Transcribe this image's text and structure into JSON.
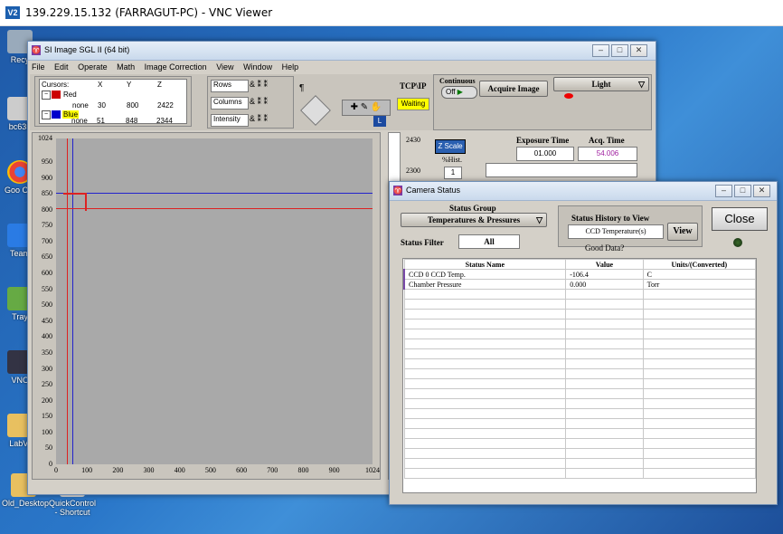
{
  "vnc": {
    "title": "139.229.15.132 (FARRAGUT-PC) - VNC Viewer",
    "logo": "V2"
  },
  "desktop": {
    "icons": [
      {
        "label": "Recy",
        "color": "#8aa"
      },
      {
        "label": "bc635",
        "color": "#ccc"
      },
      {
        "label": "Goo Chr",
        "color": "#e44"
      },
      {
        "label": "Team",
        "color": "#2a7be4"
      },
      {
        "label": "Tray",
        "color": "#8a4"
      },
      {
        "label": "VNC",
        "color": "#336"
      },
      {
        "label": "LabVI",
        "color": "#e8c060"
      },
      {
        "label": "Old_Desktop",
        "color": "#e8c060"
      },
      {
        "label": "QuickControl - Shortcut",
        "color": "#ddd"
      }
    ]
  },
  "si_window": {
    "title": "SI Image SGL II  (64 bit)",
    "menu": [
      "File",
      "Edit",
      "Operate",
      "Math",
      "Image Correction",
      "View",
      "Window",
      "Help"
    ],
    "cursors": {
      "headers": [
        "Cursors:",
        "X",
        "Y",
        "Z"
      ],
      "rows": [
        {
          "name": "Red",
          "mode": "none",
          "x": "30",
          "y": "800",
          "z": "2422"
        },
        {
          "name": "Blue",
          "mode": "none",
          "x": "51",
          "y": "848",
          "z": "2344"
        }
      ]
    },
    "profile_labels": [
      "Rows",
      "Columns",
      "Intensity"
    ],
    "tcpip_label": "TCP\\IP",
    "tcpip_status": "Waiting",
    "l_badge": "L",
    "continuous_label": "Continuous",
    "off_label": "Off",
    "acquire_label": "Acquire Image",
    "light_label": "Light",
    "zscale_label": "Z Scale",
    "hist_label": "%Hist.",
    "hist_value": "1",
    "exposure_label": "Exposure Time",
    "exposure_value": "01.000",
    "acq_label": "Acq. Time",
    "acq_value": "54.006",
    "scale_values": [
      "2430",
      "2300"
    ],
    "y_ticks": [
      "1024",
      "950",
      "900",
      "850",
      "800",
      "750",
      "700",
      "650",
      "600",
      "550",
      "500",
      "450",
      "400",
      "350",
      "300",
      "250",
      "200",
      "150",
      "100",
      "50",
      "0"
    ],
    "x_ticks": [
      "0",
      "100",
      "200",
      "300",
      "400",
      "500",
      "600",
      "700",
      "800",
      "900",
      "1024"
    ],
    "pin_icon": "¶"
  },
  "camera_status": {
    "title": "Camera Status",
    "status_group_label": "Status Group",
    "status_group_value": "Temperatures & Pressures",
    "status_filter_label": "Status Filter",
    "status_filter_value": "All",
    "history_label": "Status History to View",
    "history_value": "CCD Temperature(s)",
    "view_label": "View",
    "close_label": "Close",
    "good_data_label": "Good Data?",
    "columns": [
      "Status Name",
      "Value",
      "Units/(Converted)"
    ],
    "rows": [
      {
        "name": "CCD 0 CCD Temp.",
        "value": "-106.4",
        "units": "C"
      },
      {
        "name": "Chamber Pressure",
        "value": "0.000",
        "units": "Torr"
      }
    ]
  }
}
